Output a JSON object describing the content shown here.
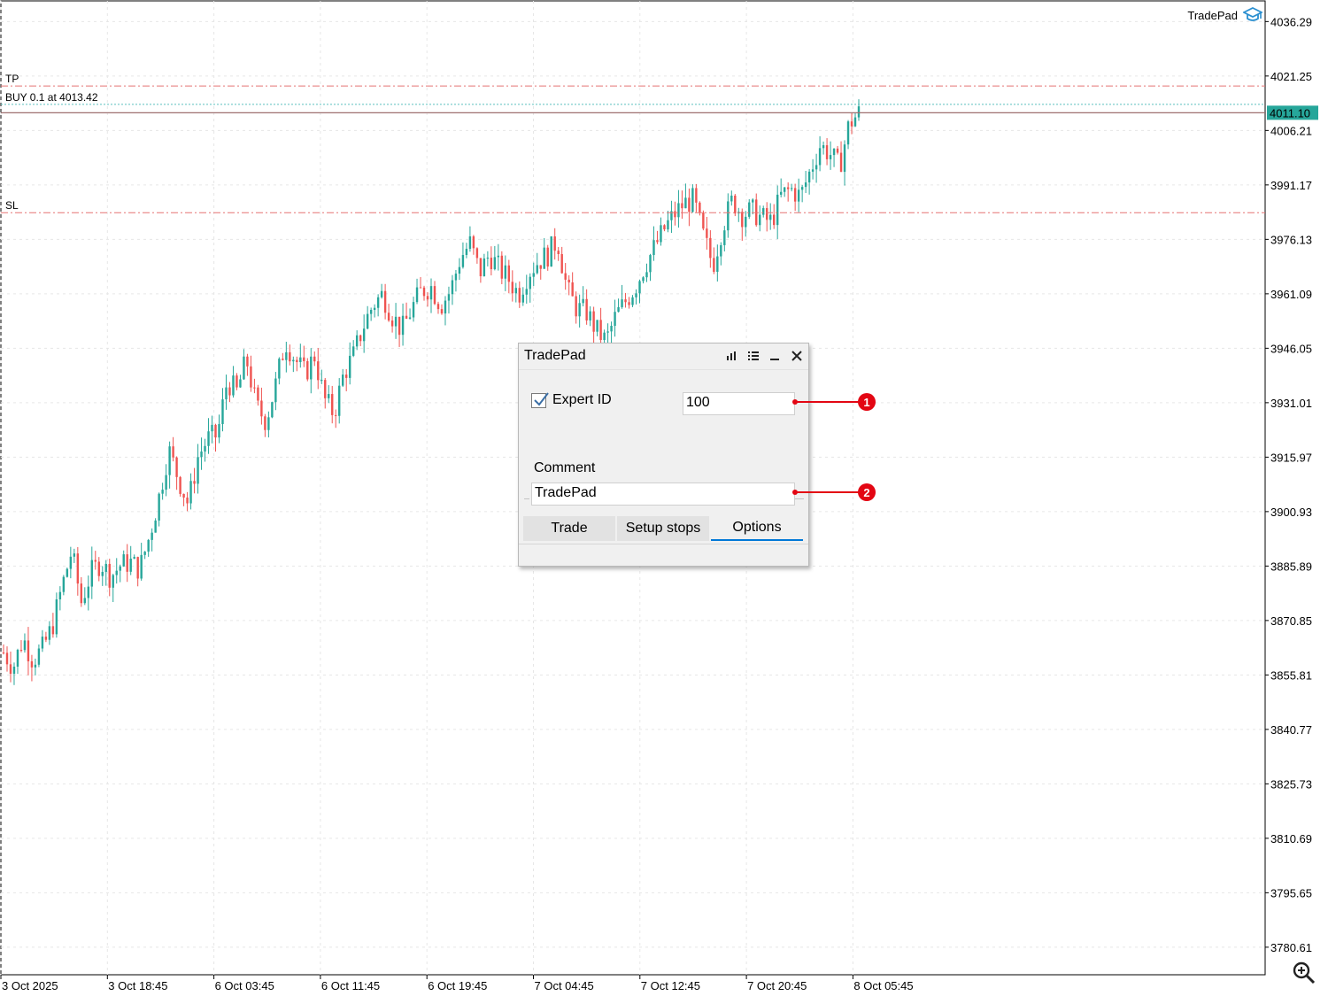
{
  "brand": {
    "label": "TradePad",
    "icon": "graduation-cap-icon",
    "icon_color": "#2a8fd0"
  },
  "chart": {
    "y_axis": [
      "4036.29",
      "4021.25",
      "4006.21",
      "3991.17",
      "3976.13",
      "3961.09",
      "3946.05",
      "3931.01",
      "3915.97",
      "3900.93",
      "3885.89",
      "3870.85",
      "3855.81",
      "3840.77",
      "3825.73",
      "3810.69",
      "3795.65",
      "3780.61"
    ],
    "x_axis": [
      "3 Oct 2025",
      "3 Oct 18:45",
      "6 Oct 03:45",
      "6 Oct 11:45",
      "6 Oct 19:45",
      "7 Oct 04:45",
      "7 Oct 12:45",
      "7 Oct 20:45",
      "8 Oct 05:45"
    ],
    "current_price": "4011.10",
    "tp_label": "TP",
    "buy_label": "BUY 0.1 at 4013.42",
    "sl_label": "SL",
    "colors": {
      "bull": "#26a69a",
      "bear": "#ef5350",
      "tp_sl_line": "#e57373",
      "buy_line": "#5bc0be",
      "price_line": "#9e7070",
      "price_tag": "#26a69a",
      "grid": "#e6e6e6"
    }
  },
  "chart_data": {
    "type": "candlestick",
    "note_close_path": [
      3862,
      3858,
      3866,
      3860,
      3863,
      3869,
      3880,
      3890,
      3876,
      3884,
      3887,
      3883,
      3886,
      3887,
      3885,
      3894,
      3905,
      3918,
      3910,
      3903,
      3916,
      3921,
      3922,
      3937,
      3934,
      3943,
      3930,
      3926,
      3936,
      3948,
      3943,
      3939,
      3944,
      3932,
      3928,
      3939,
      3944,
      3952,
      3958,
      3961,
      3955,
      3951,
      3957,
      3962,
      3963,
      3958,
      3962,
      3971,
      3975,
      3967,
      3972,
      3968,
      3965,
      3961,
      3967,
      3970,
      3972,
      3976,
      3962,
      3957,
      3956,
      3951,
      3948,
      3955,
      3959,
      3963,
      3969,
      3974,
      3979,
      3983,
      3986,
      3987,
      3977,
      3969,
      3980,
      3987,
      3983,
      3984,
      3982,
      3981,
      3988,
      3990,
      3988,
      3995,
      4002,
      4000,
      3996,
      4008,
      4011
    ],
    "ylim": [
      3773,
      4042
    ],
    "tp": 4018.5,
    "buy_price": 4013.42,
    "sl": 3983.5
  },
  "panel": {
    "title": "TradePad",
    "expert_id_label": "Expert ID",
    "expert_id_checked": true,
    "expert_id_value": "100",
    "comment_label": "Comment",
    "comment_value": "TradePad",
    "tabs": [
      {
        "label": "Trade",
        "active": false
      },
      {
        "label": "Setup stops",
        "active": false
      },
      {
        "label": "Options",
        "active": true
      }
    ]
  },
  "callouts": [
    "1",
    "2"
  ]
}
